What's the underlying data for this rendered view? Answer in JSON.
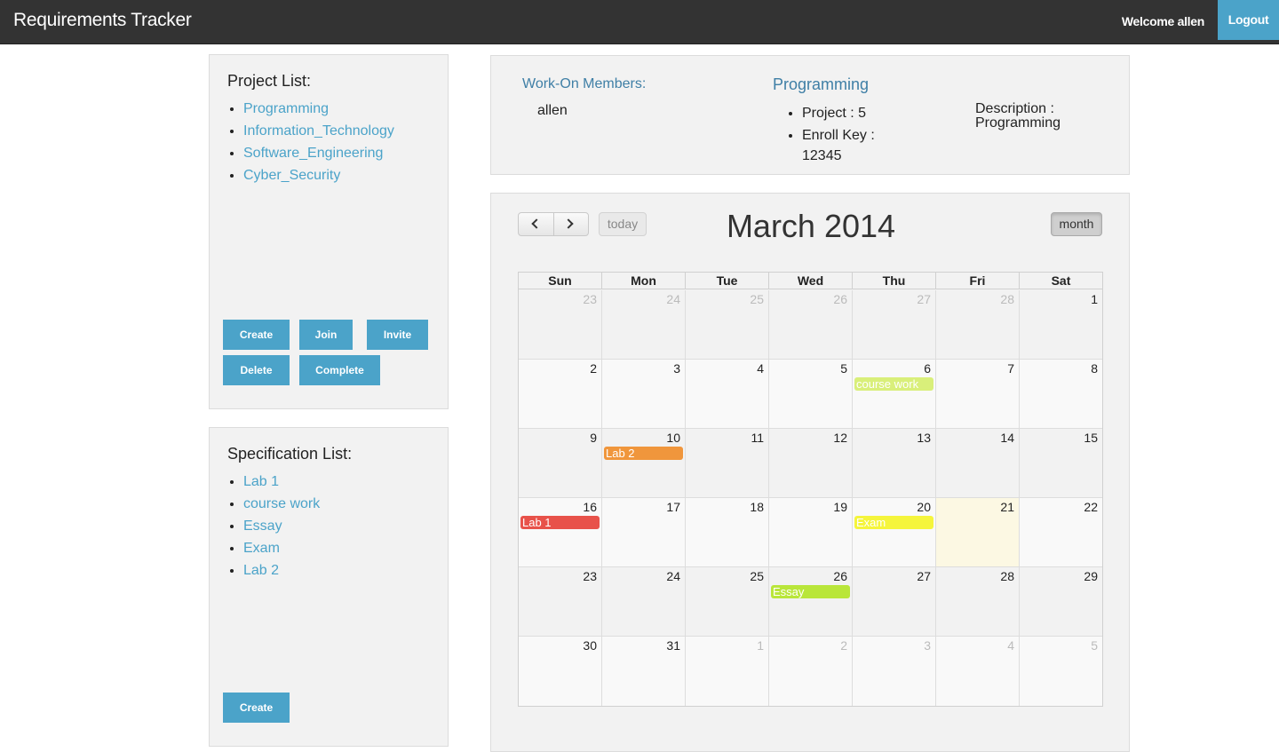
{
  "app": {
    "title": "Requirements Tracker",
    "welcome": "Welcome allen",
    "logout": "Logout"
  },
  "projects": {
    "heading": "Project List:",
    "items": [
      "Programming",
      "Information_Technology",
      "Software_Engineering",
      "Cyber_Security"
    ],
    "buttons": {
      "create": "Create",
      "join": "Join",
      "invite": "Invite",
      "delete": "Delete",
      "complete": "Complete"
    }
  },
  "specs": {
    "heading": "Specification List:",
    "items": [
      "Lab 1",
      "course work",
      "Essay",
      "Exam",
      "Lab 2"
    ],
    "create": "Create"
  },
  "info": {
    "members_label": "Work-On Members:",
    "member": "allen",
    "project_name": "Programming",
    "project_line": "Project : 5",
    "enroll_line": "Enroll Key :",
    "enroll_key": "12345",
    "description_label": "Description :",
    "description": "Programming"
  },
  "calendar": {
    "title": "March 2014",
    "today_label": "today",
    "month_label": "month",
    "weekdays": [
      "Sun",
      "Mon",
      "Tue",
      "Wed",
      "Thu",
      "Fri",
      "Sat"
    ],
    "weeks": [
      [
        23,
        24,
        25,
        26,
        27,
        28,
        1
      ],
      [
        2,
        3,
        4,
        5,
        6,
        7,
        8
      ],
      [
        9,
        10,
        11,
        12,
        13,
        14,
        15
      ],
      [
        16,
        17,
        18,
        19,
        20,
        21,
        22
      ],
      [
        23,
        24,
        25,
        26,
        27,
        28,
        29
      ],
      [
        30,
        31,
        1,
        2,
        3,
        4,
        5
      ]
    ],
    "other_month": [
      [
        0,
        0
      ],
      [
        0,
        1
      ],
      [
        0,
        2
      ],
      [
        0,
        3
      ],
      [
        0,
        4
      ],
      [
        0,
        5
      ],
      [
        5,
        2
      ],
      [
        5,
        3
      ],
      [
        5,
        4
      ],
      [
        5,
        5
      ],
      [
        5,
        6
      ]
    ],
    "today": [
      3,
      5
    ],
    "events": [
      {
        "title": "course work",
        "week": 1,
        "day": 4,
        "color": "#d9ef7a"
      },
      {
        "title": "Lab 2",
        "week": 2,
        "day": 1,
        "color": "#f0963c"
      },
      {
        "title": "Lab 1",
        "week": 3,
        "day": 0,
        "color": "#e8524a"
      },
      {
        "title": "Exam",
        "week": 3,
        "day": 4,
        "color": "#f5f53c"
      },
      {
        "title": "Essay",
        "week": 4,
        "day": 3,
        "color": "#b9e63a"
      }
    ]
  }
}
